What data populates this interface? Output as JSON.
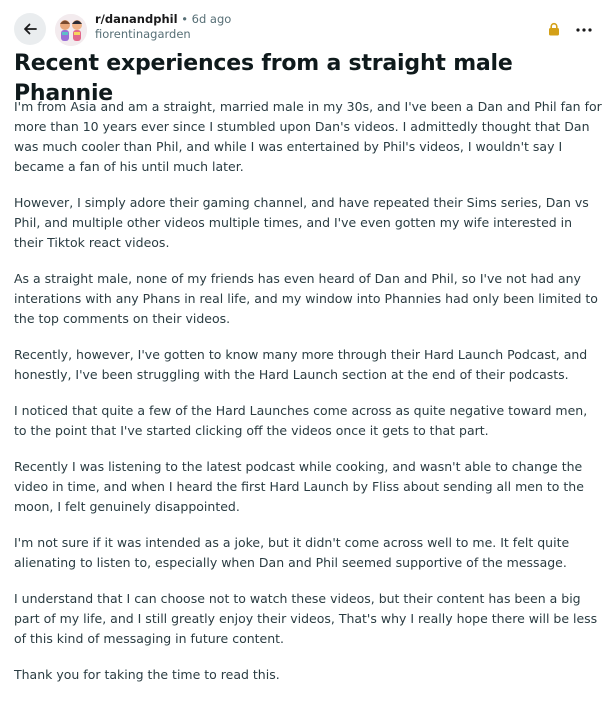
{
  "post": {
    "subreddit": "r/danandphil",
    "separator": "•",
    "age": "6d ago",
    "author": "fiorentinagarden",
    "title": "Recent experiences from a straight male Phannie",
    "paragraphs": [
      "I'm from Asia and am a straight, married male in my 30s, and I've been a Dan and Phil fan for more than 10 years ever since I stumbled upon Dan's videos. I admittedly thought that Dan was much cooler than Phil, and while I was entertained by Phil's videos, I wouldn't say I became a fan of his until much later.",
      "However, I simply adore their gaming channel, and have repeated their Sims series, Dan vs Phil, and multiple other videos multiple times, and I've even gotten my wife interested in their Tiktok react videos.",
      "As a straight male, none of my friends has even heard of Dan and Phil, so I've not had any interations with any Phans in real life, and my window into Phannies had only been limited to the top comments on their videos.",
      "Recently, however, I've gotten to know many more through their Hard Launch Podcast, and honestly, I've been struggling with the Hard Launch section at the end of their podcasts.",
      "I noticed that quite a few of the Hard Launches come across as quite negative toward men, to the point that I've started clicking off the videos once it gets to that part.",
      "Recently I was listening to the latest podcast while cooking, and wasn't able to change the video in time, and when I heard the first Hard Launch by Fliss about sending all men to the moon, I felt genuinely disappointed.",
      "I'm not sure if it was intended as a joke, but it didn't come across well to me. It felt quite alienating to listen to, especially when Dan and Phil seemed supportive of the message.",
      "I understand that I can choose not to watch these videos, but their content has been a big part of my life, and I still greatly enjoy their videos, That's why I really hope there will be less of this kind of messaging in future content.",
      "Thank you for taking the time to read this."
    ]
  },
  "icons": {
    "back": "back-arrow-icon",
    "avatar": "subreddit-avatar",
    "lock": "lock-icon",
    "more": "more-options-icon"
  },
  "colors": {
    "background": "#ffffff",
    "title": "#0f1a1c",
    "body_text": "#2a3c42",
    "meta_text": "#576f76",
    "back_button_bg": "#eaedef",
    "lock": "#d4a017"
  }
}
